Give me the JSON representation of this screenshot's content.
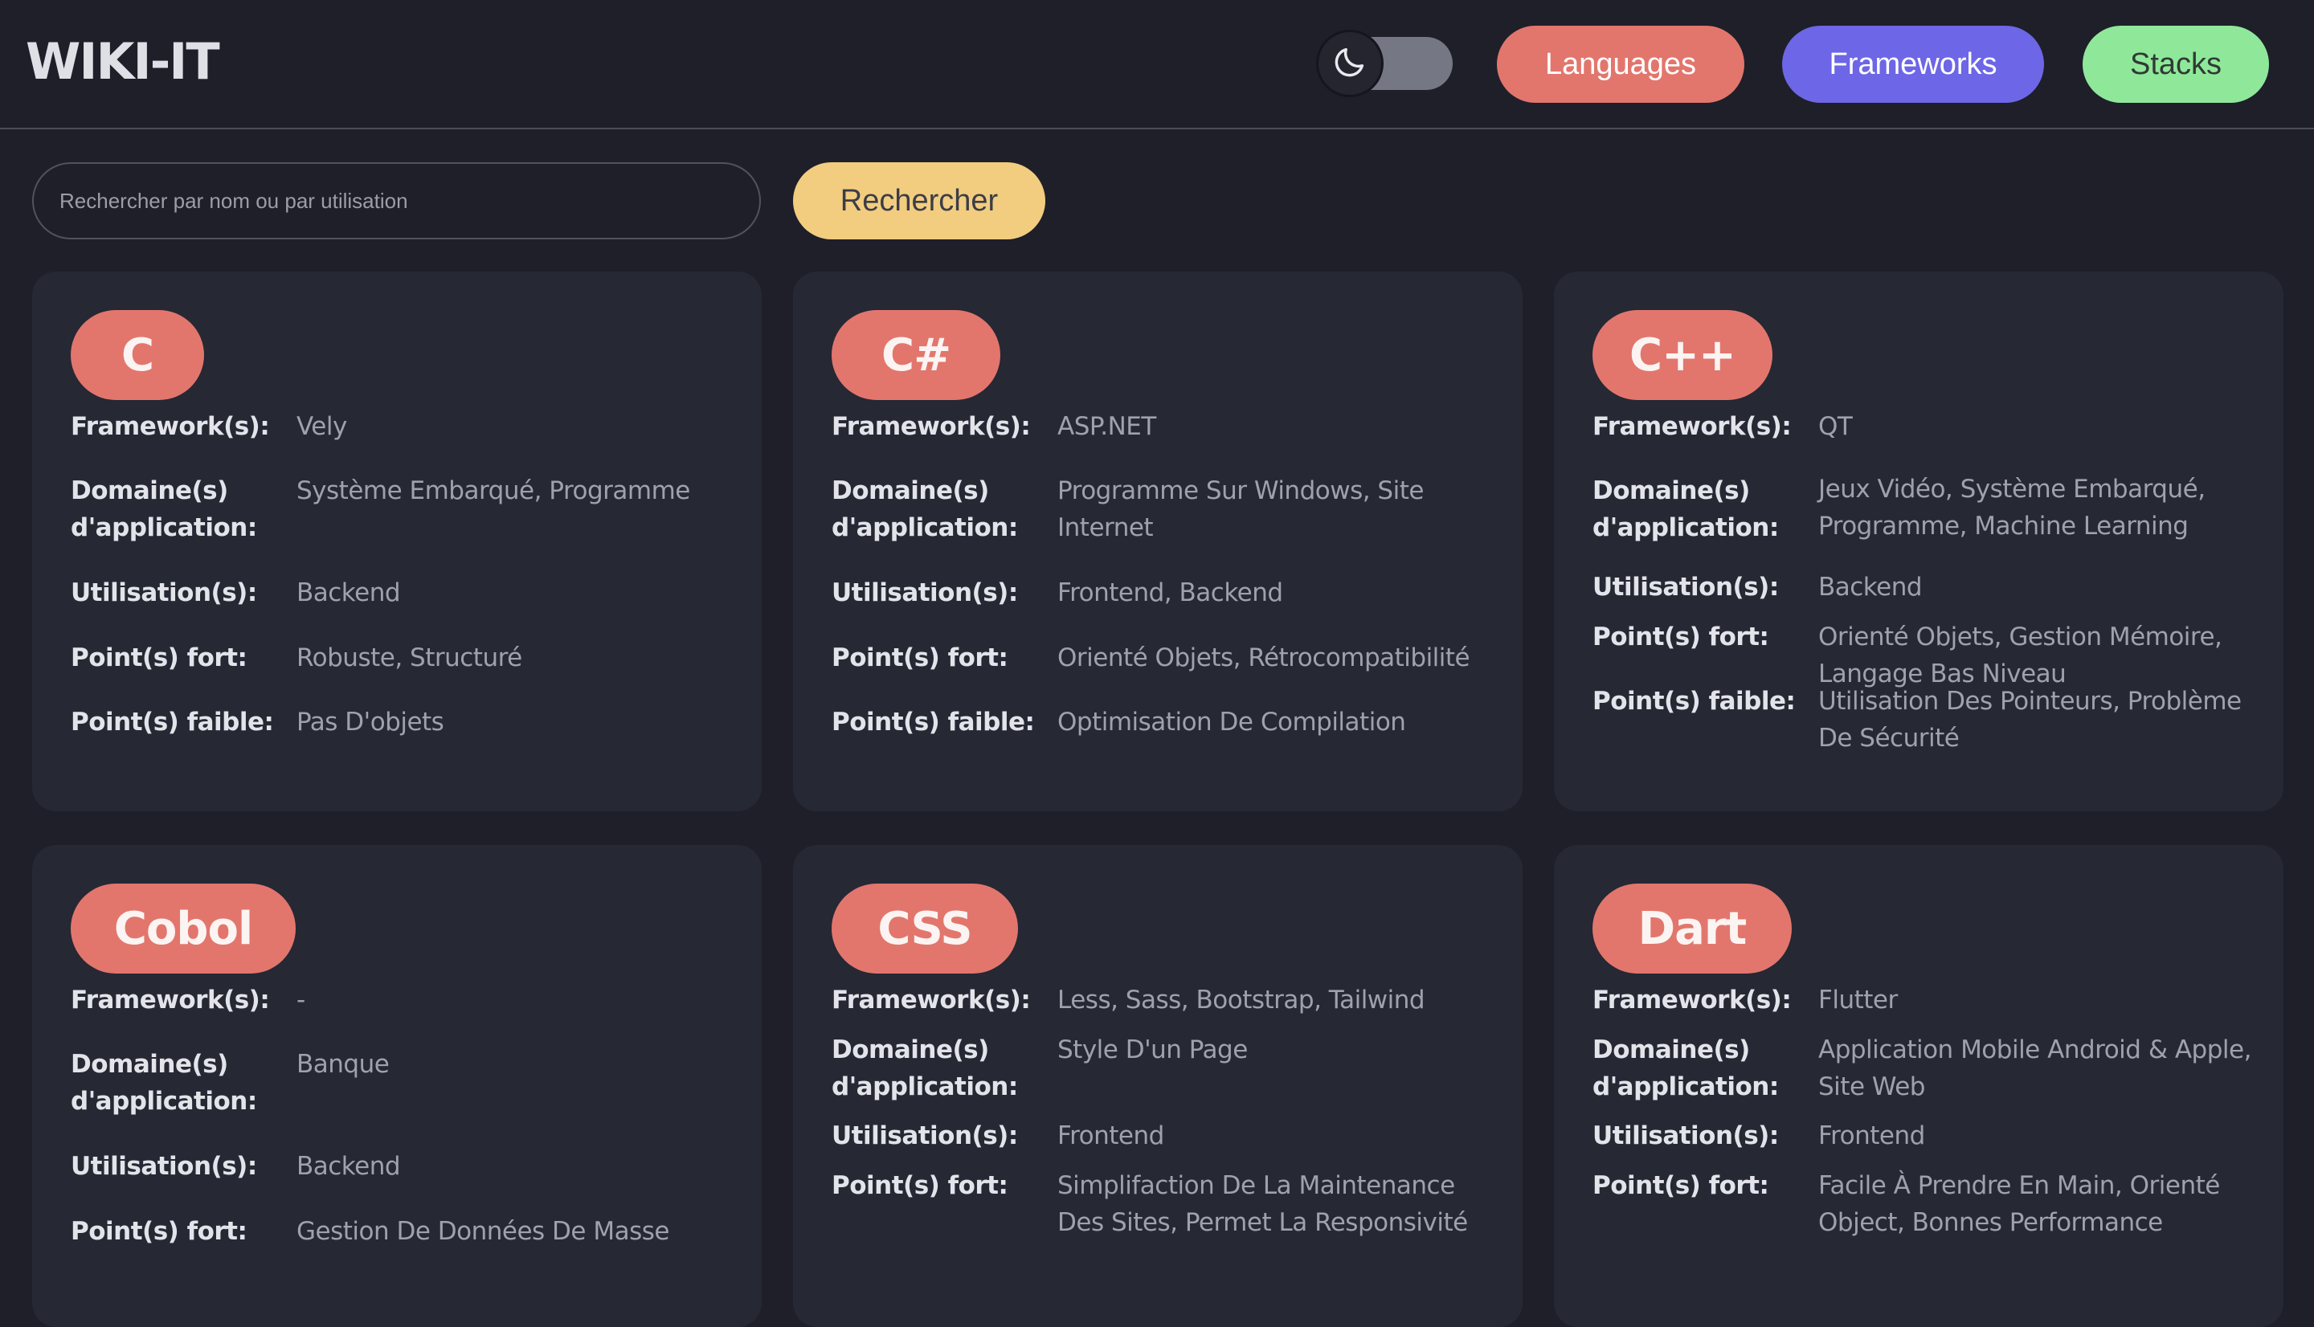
{
  "header": {
    "logo": "WIKI-IT",
    "theme_toggle": {
      "state": "dark",
      "icon": "moon-icon"
    },
    "nav": [
      {
        "label": "Languages",
        "color": "#e2766d",
        "text_color": "#ffffff"
      },
      {
        "label": "Frameworks",
        "color": "#6d66e6",
        "text_color": "#ffffff"
      },
      {
        "label": "Stacks",
        "color": "#8fe89a",
        "text_color": "#2f3a33"
      }
    ]
  },
  "search": {
    "placeholder": "Rechercher par nom ou par utilisation",
    "value": "",
    "button_label": "Rechercher",
    "button_color": "#f2cd80"
  },
  "accent_color": "#e2766d",
  "cards": [
    {
      "title": "C",
      "rows": [
        {
          "label": "Framework(s):",
          "value": "Vely"
        },
        {
          "label": "Domaine(s) d'application:",
          "value": "Système Embarqué, Programme"
        },
        {
          "label": "Utilisation(s):",
          "value": "Backend"
        },
        {
          "label": "Point(s) fort:",
          "value": "Robuste, Structuré"
        },
        {
          "label": "Point(s) faible:",
          "value": "Pas D'objets"
        }
      ]
    },
    {
      "title": "C#",
      "rows": [
        {
          "label": "Framework(s):",
          "value": "ASP.NET"
        },
        {
          "label": "Domaine(s) d'application:",
          "value": "Programme Sur Windows, Site Internet"
        },
        {
          "label": "Utilisation(s):",
          "value": "Frontend, Backend"
        },
        {
          "label": "Point(s) fort:",
          "value": "Orienté Objets, Rétrocompatibilité"
        },
        {
          "label": "Point(s) faible:",
          "value": "Optimisation De Compilation"
        }
      ]
    },
    {
      "title": "C++",
      "rows": [
        {
          "label": "Framework(s):",
          "value": "QT"
        },
        {
          "label": "Domaine(s) d'application:",
          "value": "Jeux Vidéo, Système Embarqué, Programme, Machine Learning"
        },
        {
          "label": "Utilisation(s):",
          "value": "Backend"
        },
        {
          "label": "Point(s) fort:",
          "value": "Orienté Objets, Gestion Mémoire, Langage Bas Niveau"
        },
        {
          "label": "Point(s) faible:",
          "value": "Utilisation Des Pointeurs, Problème De Sécurité"
        }
      ]
    },
    {
      "title": "Cobol",
      "rows": [
        {
          "label": "Framework(s):",
          "value": "-"
        },
        {
          "label": "Domaine(s) d'application:",
          "value": "Banque"
        },
        {
          "label": "Utilisation(s):",
          "value": "Backend"
        },
        {
          "label": "Point(s) fort:",
          "value": "Gestion De Données De Masse"
        }
      ]
    },
    {
      "title": "CSS",
      "rows": [
        {
          "label": "Framework(s):",
          "value": "Less, Sass, Bootstrap, Tailwind"
        },
        {
          "label": "Domaine(s) d'application:",
          "value": "Style D'un Page"
        },
        {
          "label": "Utilisation(s):",
          "value": "Frontend"
        },
        {
          "label": "Point(s) fort:",
          "value": "Simplifaction De La Maintenance Des Sites, Permet La Responsivité"
        }
      ]
    },
    {
      "title": "Dart",
      "rows": [
        {
          "label": "Framework(s):",
          "value": "Flutter"
        },
        {
          "label": "Domaine(s) d'application:",
          "value": "Application Mobile Android & Apple, Site Web"
        },
        {
          "label": "Utilisation(s):",
          "value": "Frontend"
        },
        {
          "label": "Point(s) fort:",
          "value": "Facile À Prendre En Main, Orienté Object, Bonnes Performance"
        }
      ]
    }
  ]
}
